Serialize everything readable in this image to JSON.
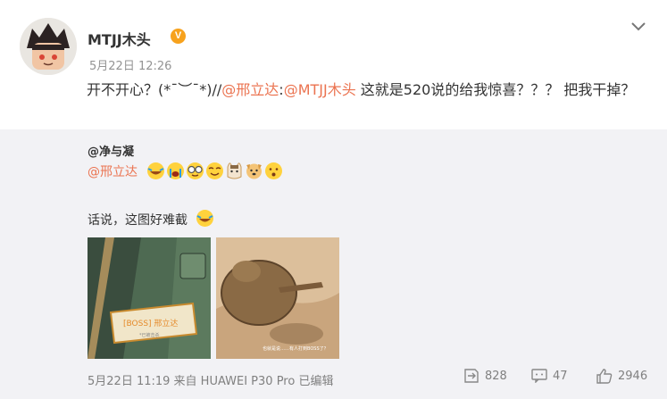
{
  "post": {
    "username": "MTJJ木头",
    "verified_badge": "V",
    "timestamp": "5月22日 12:26",
    "text_prefix": "开不开心？(*¯︶¯*)//",
    "mention1": "@邢立达",
    "separator": ":",
    "mention2": "@MTJJ木头",
    "text_suffix": " 这就是520说的给我惊喜？？？ 把我干掉？"
  },
  "retweet": {
    "original_user": "@净与凝",
    "mention": "@邢立达",
    "emoji_icons": [
      "laugh-cry-emoji",
      "crying-emoji",
      "glasses-emoji",
      "smirk-emoji",
      "cat-emoji",
      "dog-emoji",
      "think-emoji"
    ],
    "line2": "话说，这图好难截",
    "image1_caption": "[BOSS] 邢立达",
    "image1_subcaption": "*已被击杀",
    "image2_caption": "也就是说……有人打到BOSS了？",
    "footer_time": "5月22日 11:19 来自 HUAWEI P30 Pro   已编辑",
    "repost_count": "828",
    "comment_count": "47",
    "like_count": "2946"
  },
  "colors": {
    "accent": "#eb7350",
    "retweet_bg": "#f2f2f5",
    "badge": "#f7a21d"
  }
}
